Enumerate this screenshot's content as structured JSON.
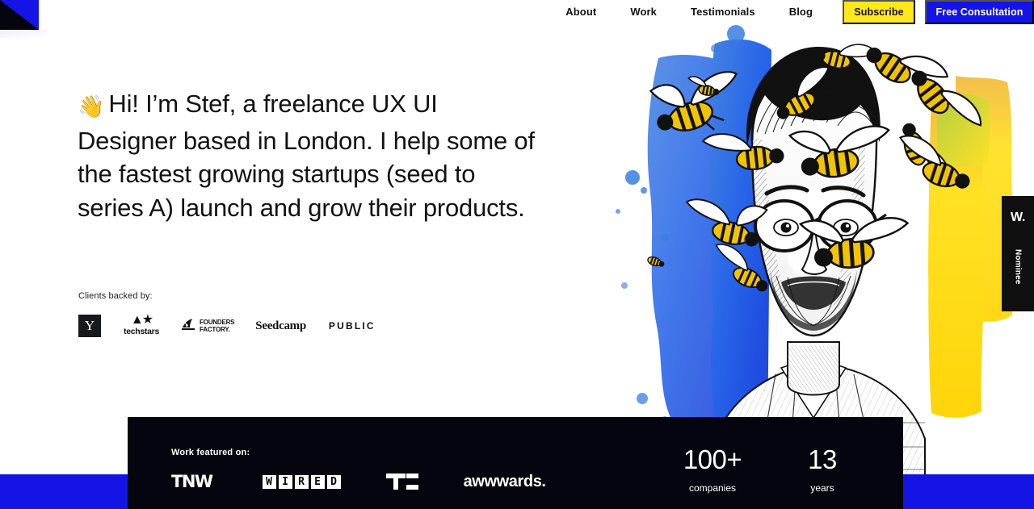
{
  "nav": {
    "links": [
      {
        "label": "About"
      },
      {
        "label": "Work"
      },
      {
        "label": "Testimonials"
      },
      {
        "label": "Blog"
      }
    ],
    "subscribe_label": "Subscribe",
    "consultation_label": "Free Consultation"
  },
  "hero": {
    "wave_emoji": "👋",
    "heading": "Hi! I’m Stef, a freelance UX UI Designer based in London. I help some of the fastest growing startups (seed to series A) launch and grow their products.",
    "clients_label": "Clients backed by:",
    "client_logos": [
      {
        "name": "y-combinator",
        "mark": "Y"
      },
      {
        "name": "techstars",
        "mark": "▲★",
        "word": "techstars"
      },
      {
        "name": "founders-factory",
        "line1": "FOUNDERS",
        "line2": "FACTORY."
      },
      {
        "name": "seedcamp",
        "word": "Seedcamp"
      },
      {
        "name": "public",
        "word": "PUBLIC"
      }
    ]
  },
  "badge": {
    "mark": "W.",
    "label": "Nominee"
  },
  "featured": {
    "label": "Work featured on:",
    "logos": [
      {
        "name": "tnw",
        "word": "TNW"
      },
      {
        "name": "wired",
        "letters": [
          "W",
          "I",
          "R",
          "E",
          "D"
        ]
      },
      {
        "name": "techcrunch",
        "word": "TC"
      },
      {
        "name": "awwwards",
        "word": "awwwards."
      }
    ],
    "stats": [
      {
        "value": "100+",
        "label": "companies"
      },
      {
        "value": "13",
        "label": "years"
      }
    ]
  },
  "colors": {
    "blue": "#1414e6",
    "yellow": "#ffe81a",
    "dark": "#05050f",
    "badge_dark": "#101010"
  }
}
